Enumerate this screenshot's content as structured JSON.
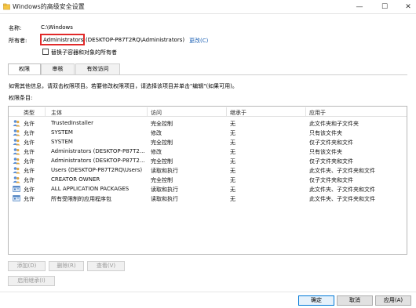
{
  "window": {
    "title": "Windows的高级安全设置",
    "min": "—",
    "max": "☐",
    "close": "✕"
  },
  "header": {
    "name_label": "名称:",
    "name_value": "C:\\Windows",
    "owner_label": "所有者:",
    "owner_value": "Administrators",
    "owner_rest": "(DESKTOP-P87T2RQ\\Administrators)",
    "change_link": "更改(C)",
    "replace_owner_label": "替换子容器和对象的所有者"
  },
  "tabs": [
    "权限",
    "审核",
    "有效访问"
  ],
  "info": {
    "line1": "如需其他信息，请双击权限项目。若要修改权限项目，请选择该项目并单击\"编辑\"(如果可用)。",
    "line2": "权限条目:"
  },
  "columns": [
    "类型",
    "主体",
    "访问",
    "继承于",
    "应用于"
  ],
  "rows": [
    {
      "type": "允许",
      "principal": "TrustedInstaller",
      "access": "完全控制",
      "inherit": "无",
      "applies": "此文件夹和子文件夹",
      "icon": "user-group-icon"
    },
    {
      "type": "允许",
      "principal": "SYSTEM",
      "access": "修改",
      "inherit": "无",
      "applies": "只有该文件夹",
      "icon": "user-group-icon"
    },
    {
      "type": "允许",
      "principal": "SYSTEM",
      "access": "完全控制",
      "inherit": "无",
      "applies": "仅子文件夹和文件",
      "icon": "user-group-icon"
    },
    {
      "type": "允许",
      "principal": "Administrators (DESKTOP-P87T2...",
      "access": "修改",
      "inherit": "无",
      "applies": "只有该文件夹",
      "icon": "user-group-icon"
    },
    {
      "type": "允许",
      "principal": "Administrators (DESKTOP-P87T2...",
      "access": "完全控制",
      "inherit": "无",
      "applies": "仅子文件夹和文件",
      "icon": "user-group-icon"
    },
    {
      "type": "允许",
      "principal": "Users (DESKTOP-P87T2RQ\\Users)",
      "access": "读取和执行",
      "inherit": "无",
      "applies": "此文件夹、子文件夹和文件",
      "icon": "user-group-icon"
    },
    {
      "type": "允许",
      "principal": "CREATOR OWNER",
      "access": "完全控制",
      "inherit": "无",
      "applies": "仅子文件夹和文件",
      "icon": "user-group-icon"
    },
    {
      "type": "允许",
      "principal": "ALL APPLICATION PACKAGES",
      "access": "读取和执行",
      "inherit": "无",
      "applies": "此文件夹、子文件夹和文件",
      "icon": "app-package-icon"
    },
    {
      "type": "允许",
      "principal": "所有受限制的应用程序包",
      "access": "读取和执行",
      "inherit": "无",
      "applies": "此文件夹、子文件夹和文件",
      "icon": "app-package-icon"
    }
  ],
  "buttons": {
    "add": "添加(D)",
    "remove": "删除(R)",
    "view": "查看(V)",
    "enable_inheritance": "启用继承(I)",
    "ok": "确定",
    "cancel": "取消",
    "apply": "应用(A)"
  }
}
